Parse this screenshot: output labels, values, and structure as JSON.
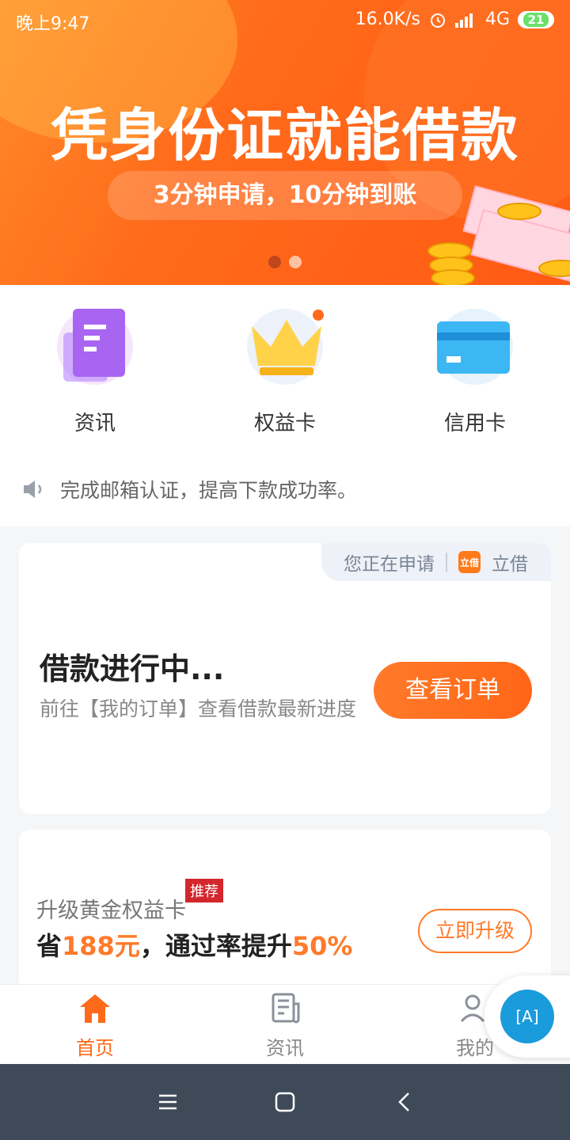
{
  "status_bar": {
    "time": "晚上9:47",
    "net_speed": "16.0K/s",
    "network": "4G",
    "battery": "21"
  },
  "banner": {
    "headline": "凭身份证就能借款",
    "subline": "3分钟申请，10分钟到账",
    "page_count": 2,
    "active_page": 1
  },
  "shortcuts": [
    {
      "label": "资讯",
      "icon": "document-icon"
    },
    {
      "label": "权益卡",
      "icon": "crown-icon"
    },
    {
      "label": "信用卡",
      "icon": "credit-card-icon"
    }
  ],
  "notice": {
    "icon": "speaker-icon",
    "text": "完成邮箱认证，提高下款成功率。"
  },
  "loan_card": {
    "applying_label": "您正在申请",
    "app_logo_text": "立借",
    "app_name": "立借",
    "title": "借款进行中...",
    "description": "前往【我的订单】查看借款最新进度",
    "button": "查看订单"
  },
  "upgrade_card": {
    "label": "升级黄金权益卡",
    "badge": "推荐",
    "save_prefix": "省",
    "save_amount": "188元",
    "middle_text": "，通过率提升",
    "rate": "50%",
    "button": "立即升级"
  },
  "tabbar": [
    {
      "label": "首页",
      "icon": "home-icon",
      "active": true
    },
    {
      "label": "资讯",
      "icon": "news-icon",
      "active": false
    },
    {
      "label": "我的",
      "icon": "profile-icon",
      "active": false
    }
  ],
  "floating_button": {
    "text": "[A]",
    "icon": "accessibility-icon"
  },
  "colors": {
    "accent": "#ff6a1a",
    "nav_bg": "#3e4a58"
  }
}
